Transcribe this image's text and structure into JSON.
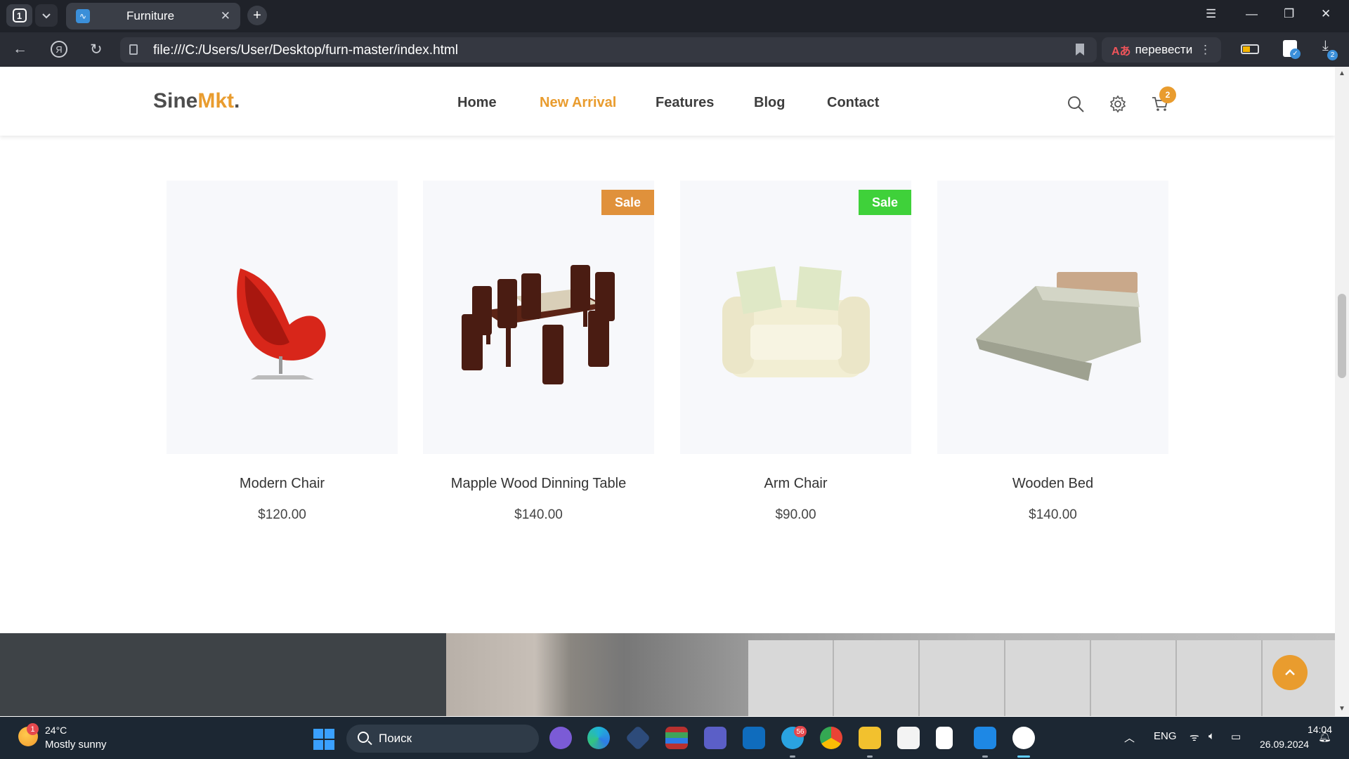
{
  "browser": {
    "tab_count": "1",
    "tab_title": "Furniture",
    "url": "file:///C:/Users/User/Desktop/furn-master/index.html",
    "translate_label": "перевести",
    "downloads_badge": "2"
  },
  "site": {
    "logo_main": "Sine",
    "logo_accent": "Mkt",
    "logo_dot": ".",
    "nav": [
      "Home",
      "New Arrival",
      "Features",
      "Blog",
      "Contact"
    ],
    "active_nav": "New Arrival",
    "cart_count": "2",
    "accent_color": "#e99c2e"
  },
  "products": [
    {
      "name": "Modern Chair",
      "price": "$120.00",
      "badge": ""
    },
    {
      "name": "Mapple Wood Dinning Table",
      "price": "$140.00",
      "badge": "Sale",
      "badge_color": "#e0913b"
    },
    {
      "name": "Arm Chair",
      "price": "$90.00",
      "badge": "Sale",
      "badge_color": "#3fd13a"
    },
    {
      "name": "Wooden Bed",
      "price": "$140.00",
      "badge": ""
    }
  ],
  "taskbar": {
    "weather_temp": "24°C",
    "weather_desc": "Mostly sunny",
    "weather_badge": "1",
    "search_label": "Поиск",
    "telegram_badge": "56",
    "language": "ENG",
    "time": "14:04",
    "date": "26.09.2024"
  }
}
